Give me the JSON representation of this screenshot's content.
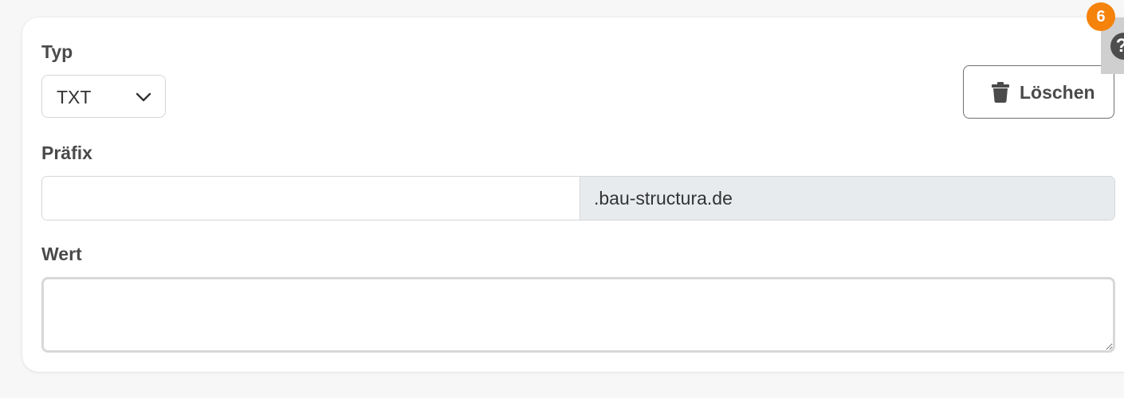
{
  "form": {
    "type_label": "Typ",
    "type_value": "TXT",
    "prefix_label": "Präfix",
    "prefix_value": "",
    "domain_suffix": ".bau-structura.de",
    "value_label": "Wert",
    "value_text": ""
  },
  "actions": {
    "delete_label": "Löschen",
    "delete_icon": "trash-icon"
  },
  "help": {
    "badge_count": "6",
    "icon": "question-icon",
    "glyph": "?"
  },
  "colors": {
    "badge": "#f5820b",
    "suffix_background": "#e8ebee",
    "help_tab": "#cfcfcf"
  }
}
